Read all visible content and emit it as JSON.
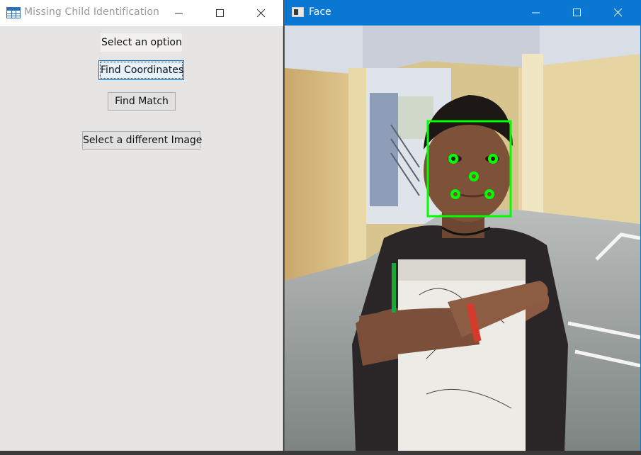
{
  "left_window": {
    "title": "Missing Child Identification",
    "label": "Select an option",
    "buttons": {
      "find_coordinates": "Find Coordinates",
      "find_match": "Find Match",
      "select_image": "Select a different Image"
    }
  },
  "right_window": {
    "title": "Face"
  },
  "colors": {
    "accent": "#0078d7",
    "titlebar_active": "#0a78d2",
    "detection": "#00ff00"
  },
  "icons": [
    "table-icon",
    "minimize-icon",
    "maximize-icon",
    "close-icon",
    "image-window-icon"
  ]
}
